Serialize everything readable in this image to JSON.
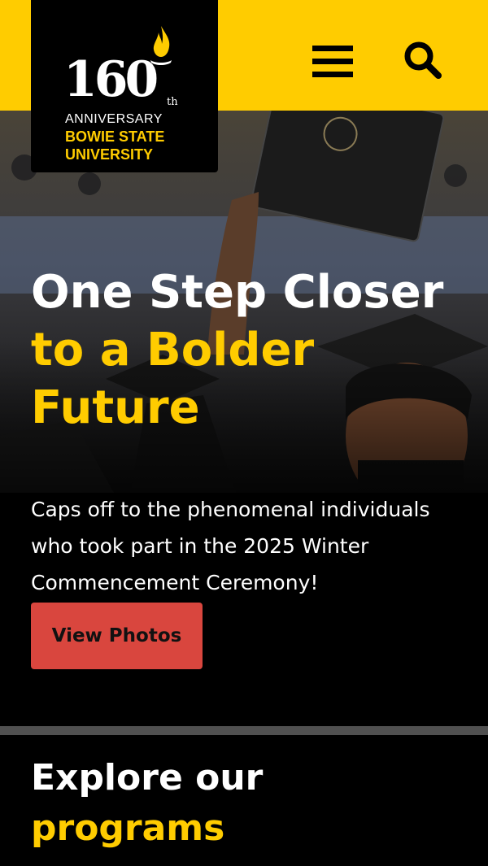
{
  "logo": {
    "number": "160",
    "suffix": "th",
    "anniversary": "ANNIVERSARY",
    "university_line1": "BOWIE STATE",
    "university_line2": "UNIVERSITY"
  },
  "header": {
    "menu_icon": "hamburger-menu-icon",
    "search_icon": "search-icon",
    "background_color": "#ffcc00"
  },
  "hero": {
    "title_line1": "One Step Closer",
    "title_line2": "to a Bolder",
    "title_line3": "Future",
    "description": "Caps off to the phenomenal individuals who took part in the 2025 Winter Commencement Ceremony!",
    "button_label": "View Photos"
  },
  "explore": {
    "title_line1": "Explore our",
    "title_line2": "programs"
  },
  "colors": {
    "brand_gold": "#ffcc00",
    "brand_black": "#000000",
    "button_red": "#d9463e"
  }
}
